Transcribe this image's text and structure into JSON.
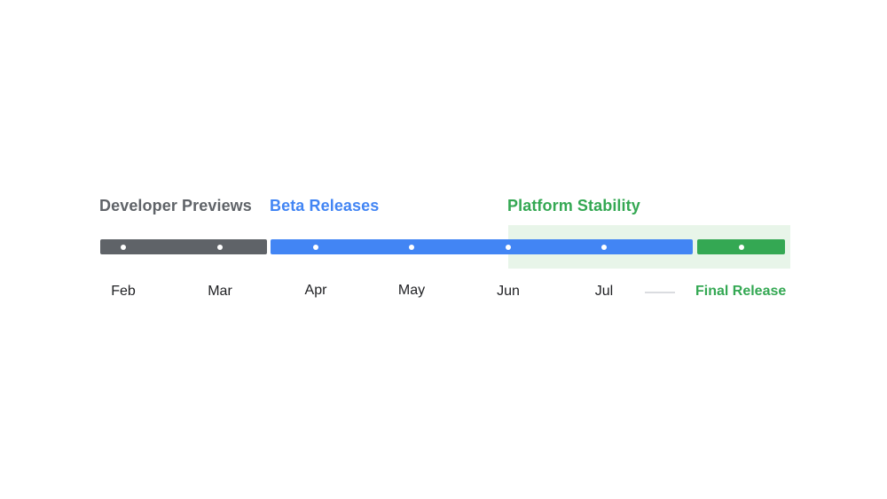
{
  "colors": {
    "developer": "#5f6368",
    "beta": "#4285f4",
    "stable": "#34a853",
    "stable_text": "#34a853",
    "stability_zone": "#e8f5e9"
  },
  "phases": {
    "developer": "Developer Previews",
    "beta": "Beta Releases",
    "stability": "Platform Stability"
  },
  "months": [
    "Feb",
    "Mar",
    "Apr",
    "May",
    "Jun",
    "Jul"
  ],
  "final_release": "Final Release"
}
